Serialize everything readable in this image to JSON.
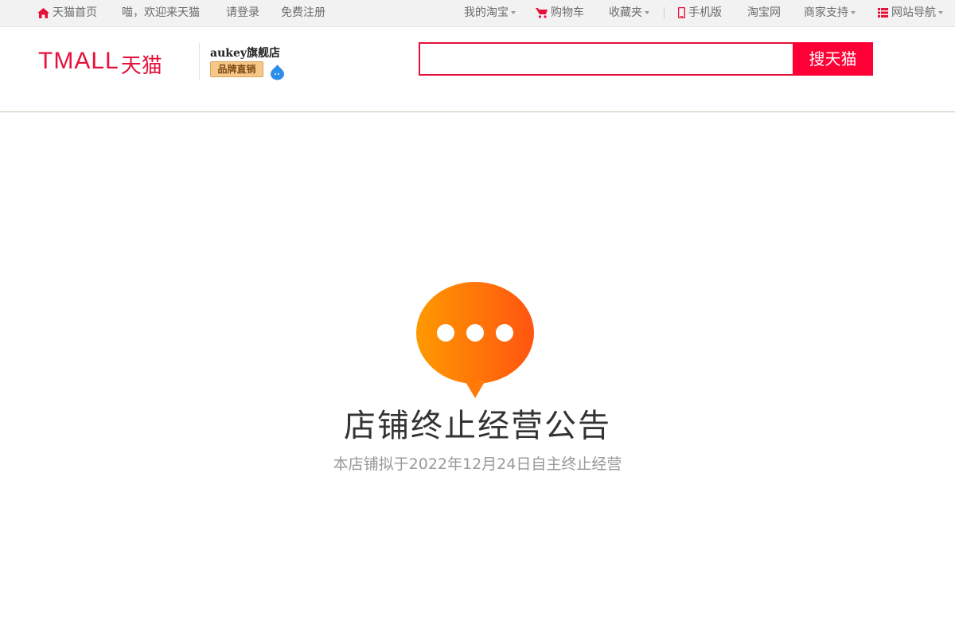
{
  "topbar": {
    "home": "天猫首页",
    "welcome": "喵，欢迎来天猫",
    "login": "请登录",
    "register": "免费注册",
    "my_taobao": "我的淘宝",
    "cart": "购物车",
    "favorites": "收藏夹",
    "mobile": "手机版",
    "taobao": "淘宝网",
    "merchant_support": "商家支持",
    "site_nav": "网站导航"
  },
  "header": {
    "logo_text": "TMALL",
    "logo_cn": "天猫",
    "shop_name": "aukey旗舰店",
    "shop_badge": "品牌直销",
    "search_placeholder": "",
    "search_button": "搜天猫"
  },
  "notice": {
    "title": "店铺终止经营公告",
    "message": "本店铺拟于2022年12月24日自主终止经营"
  },
  "colors": {
    "brand": "#e5113b",
    "search_button": "#ff0036",
    "bubble_start": "#ff9900",
    "bubble_end": "#ff5511"
  }
}
